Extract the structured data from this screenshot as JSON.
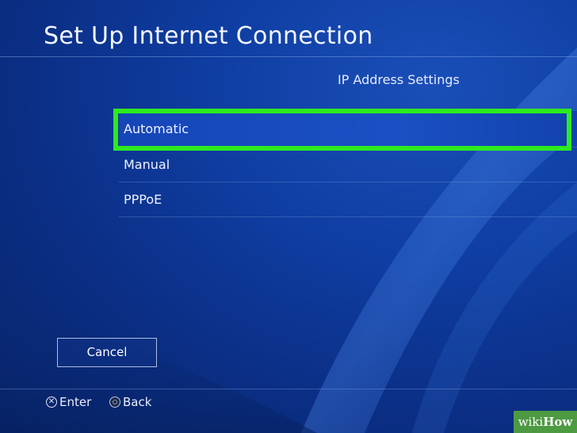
{
  "screen": {
    "title": "Set Up Internet Connection",
    "subtitle": "IP Address Settings"
  },
  "menu": {
    "items": [
      {
        "label": "Automatic",
        "selected": true
      },
      {
        "label": "Manual",
        "selected": false
      },
      {
        "label": "PPPoE",
        "selected": false
      }
    ]
  },
  "footer": {
    "cancel_label": "Cancel",
    "hints": {
      "enter_label": "Enter",
      "enter_icon": "cross-button-icon",
      "back_label": "Back",
      "back_icon": "circle-button-icon"
    }
  },
  "watermark": {
    "part1": "wiki",
    "part2": "How"
  },
  "colors": {
    "background": "#0f3ea3",
    "highlight": "#2dea1f",
    "watermark": "#4d9a42"
  }
}
